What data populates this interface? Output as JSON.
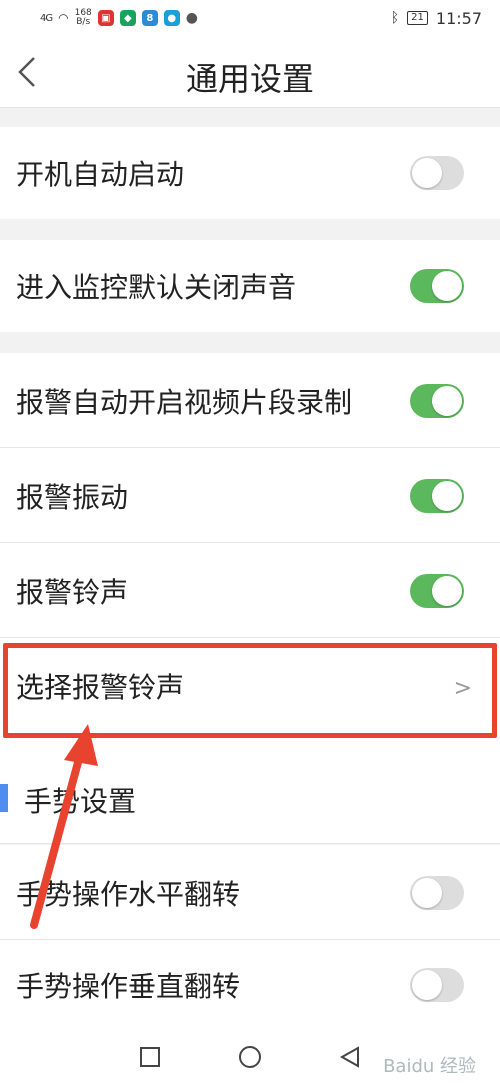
{
  "status_bar": {
    "signal": "4G",
    "speed_value": "168",
    "speed_unit": "B/s",
    "time": "11:57",
    "battery": "21"
  },
  "header": {
    "title": "通用设置"
  },
  "settings": {
    "auto_start": {
      "label": "开机自动启动",
      "enabled": false
    },
    "mute_on_monitor": {
      "label": "进入监控默认关闭声音",
      "enabled": true
    },
    "alarm_record": {
      "label": "报警自动开启视频片段录制",
      "enabled": true
    },
    "alarm_vibrate": {
      "label": "报警振动",
      "enabled": true
    },
    "alarm_ringtone": {
      "label": "报警铃声",
      "enabled": true
    },
    "select_ringtone": {
      "label": "选择报警铃声"
    }
  },
  "gesture_section": {
    "title": "手势设置",
    "horizontal_flip": {
      "label": "手势操作水平翻转",
      "enabled": false
    },
    "vertical_flip": {
      "label": "手势操作垂直翻转",
      "enabled": false
    }
  },
  "watermark": "Baidu 经验",
  "colors": {
    "switch_on": "#5cb85c",
    "switch_off": "#dddddd",
    "accent_bar": "#4f8ef0",
    "annotation": "#e8432e"
  }
}
